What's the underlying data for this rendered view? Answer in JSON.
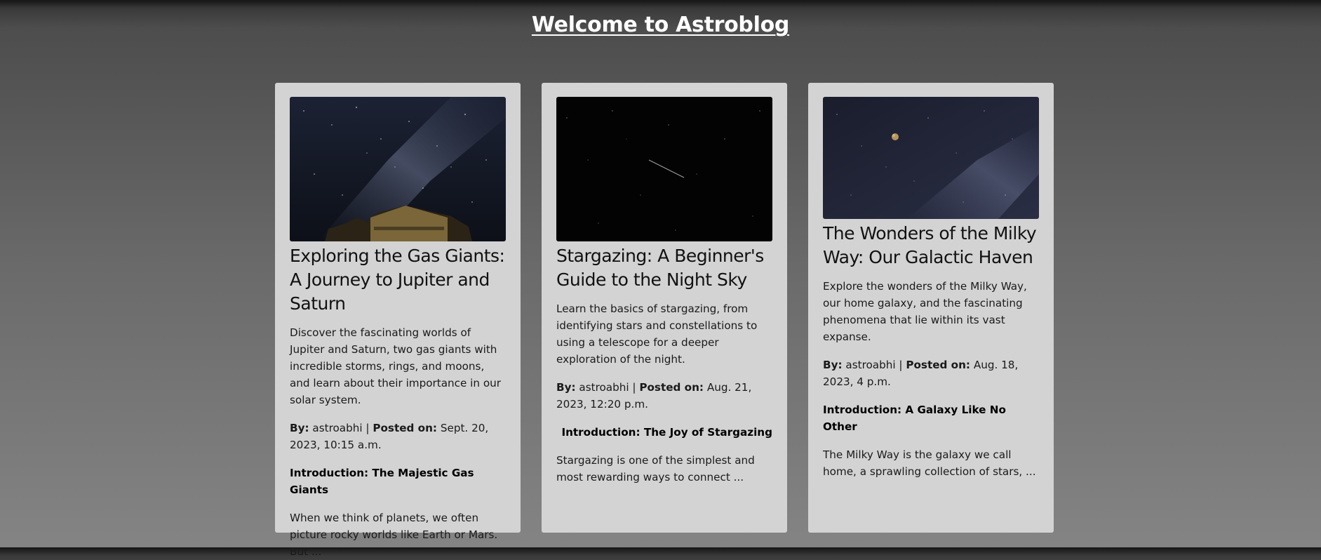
{
  "site": {
    "title": "Welcome to Astroblog"
  },
  "posts": [
    {
      "title": "Exploring the Gas Giants: A Journey to Jupiter and Saturn",
      "excerpt": "Discover the fascinating worlds of Jupiter and Saturn, two gas giants with incredible storms, rings, and moons, and learn about their importance in our solar system.",
      "by_label": "By:",
      "author": "astroabhi",
      "separator": "|",
      "posted_label": "Posted on:",
      "date": "Sept. 20, 2023, 10:15 a.m.",
      "intro": "Introduction: The Majestic Gas Giants",
      "body": "When we think of planets, we often picture rocky worlds like Earth or Mars. But ..."
    },
    {
      "title": "Stargazing: A Beginner's Guide to the Night Sky",
      "excerpt": "Learn the basics of stargazing, from identifying stars and constellations to using a telescope for a deeper exploration of the night.",
      "by_label": "By:",
      "author": "astroabhi",
      "separator": "|",
      "posted_label": "Posted on:",
      "date": "Aug. 21, 2023, 12:20 p.m.",
      "intro": "Introduction: The Joy of Stargazing",
      "body": "Stargazing is one of the simplest and most rewarding ways to connect ..."
    },
    {
      "title": "The Wonders of the Milky Way: Our Galactic Haven",
      "excerpt": "Explore the wonders of the Milky Way, our home galaxy, and the fascinating phenomena that lie within its vast expanse.",
      "by_label": "By:",
      "author": "astroabhi",
      "separator": "|",
      "posted_label": "Posted on:",
      "date": "Aug. 18, 2023, 4 p.m.",
      "intro": "Introduction: A Galaxy Like No Other",
      "body": "The Milky Way is the galaxy we call home, a sprawling collection of stars, ..."
    }
  ]
}
